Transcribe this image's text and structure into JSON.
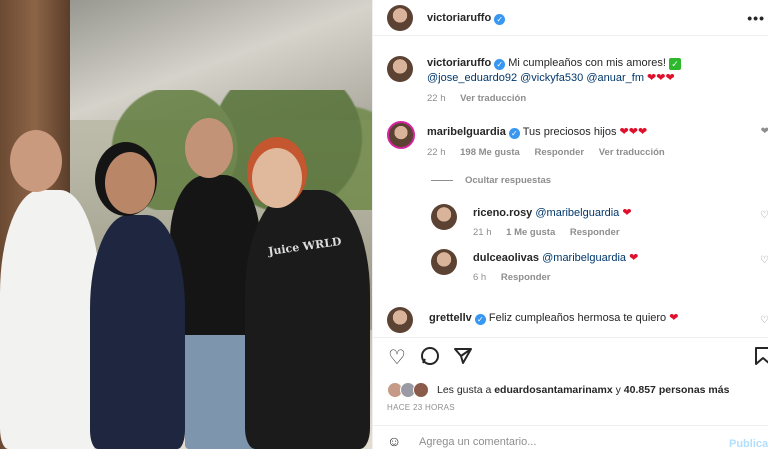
{
  "photo": {
    "shirt_text": "Juice WRLD"
  },
  "header": {
    "username": "victoriaruffo",
    "verified_glyph": "✓",
    "more_glyph": "•••"
  },
  "caption": {
    "username": "victoriaruffo",
    "text": "Mi cumpleaños con mis amores!",
    "check_emoji": "✓",
    "mentions": [
      "@jose_eduardo92",
      "@vickyfa530",
      "@anuar_fm"
    ],
    "hearts": "❤❤❤",
    "time": "22 h",
    "translate": "Ver traducción"
  },
  "comments": [
    {
      "username": "maribelguardia",
      "verified": true,
      "text": "Tus preciosos hijos",
      "hearts": "❤❤❤",
      "time": "22 h",
      "likes": "198 Me gusta",
      "reply": "Responder",
      "translate": "Ver traducción"
    }
  ],
  "hide_replies": "Ocultar respuestas",
  "replies": [
    {
      "username": "riceno.rosy",
      "mention": "@maribelguardia",
      "hearts": "❤",
      "time": "21 h",
      "likes": "1 Me gusta",
      "reply": "Responder"
    },
    {
      "username": "dulceaolivas",
      "mention": "@maribelguardia",
      "hearts": "❤",
      "time": "6 h",
      "reply": "Responder"
    }
  ],
  "last_comment": {
    "username": "grettellv",
    "verified": true,
    "text": "Feliz cumpleaños hermosa te quiero",
    "hearts": "❤"
  },
  "likes": {
    "prefix": "Les gusta a",
    "user": "eduardosantamarinamx",
    "and": "y",
    "count": "40.857 personas más"
  },
  "timeago": "HACE 23 HORAS",
  "add_comment": {
    "placeholder": "Agrega un comentario...",
    "publish": "Publicar"
  },
  "icons": {
    "like": "heart-outline-icon",
    "comment": "comment-icon",
    "share": "paper-plane-icon",
    "save": "bookmark-icon",
    "emoji": "smiley-icon"
  },
  "colors": {
    "verified": "#3897f0",
    "heart": "#e0102c",
    "mention": "#00376b",
    "muted": "#8e8e8e",
    "publish": "#b2dffc"
  }
}
